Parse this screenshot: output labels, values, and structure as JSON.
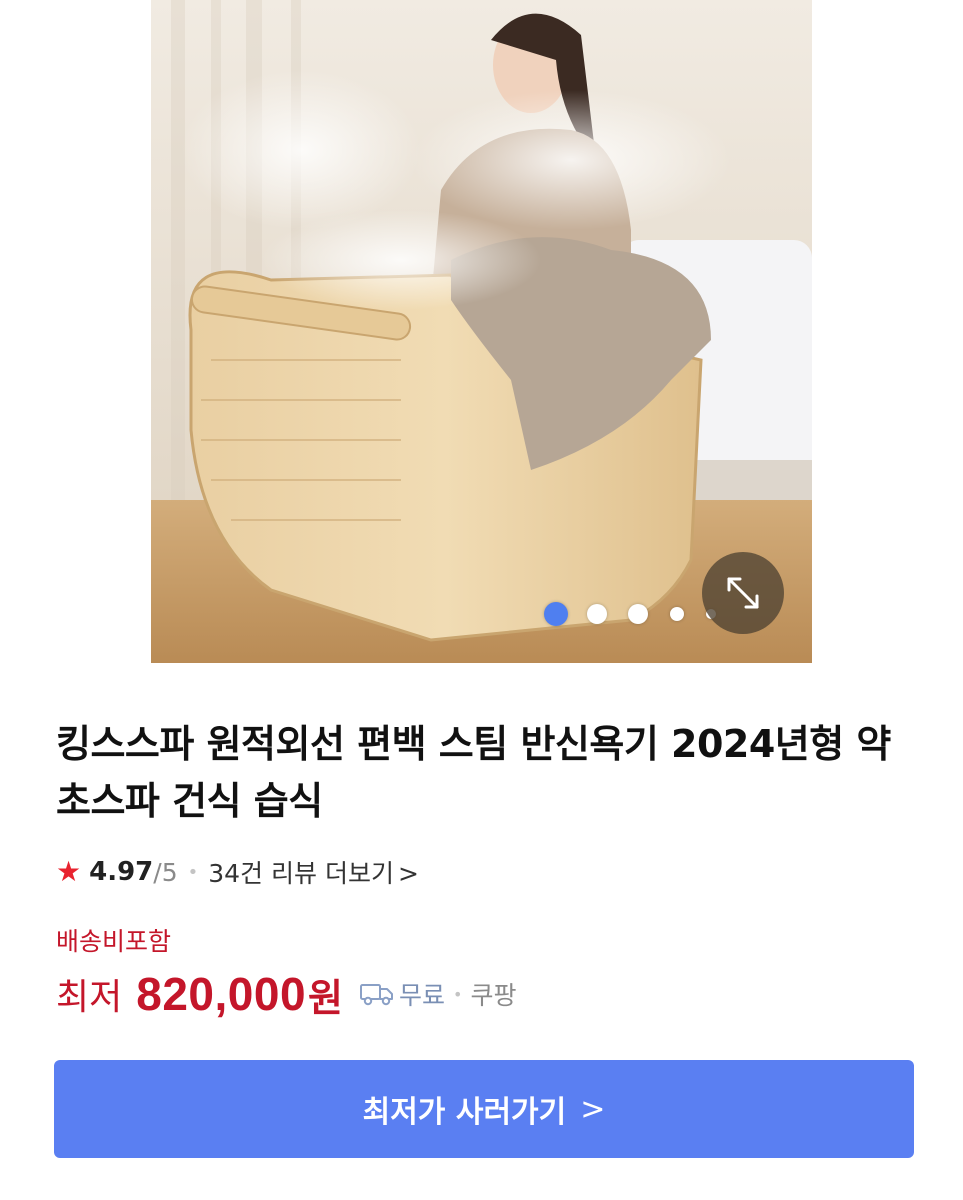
{
  "product": {
    "image_alt": "Wooden steam half-bath spa with woman",
    "carousel": {
      "total": 5,
      "active_index": 0
    },
    "title": "킹스스파 원적외선 편백 스팀 반신욕기 2024년형 약초스파 건식 습식",
    "rating": {
      "score": "4.97",
      "max": "/5",
      "review_link": "34건 리뷰 더보기",
      "chevron": ">"
    }
  },
  "pricing": {
    "shipping_label": "배송비포함",
    "prefix": "최저",
    "value": "820,000",
    "unit": "원",
    "delivery": "무료",
    "seller": "쿠팡"
  },
  "cta": {
    "label": "최저가 사러가기",
    "chevron": ">"
  },
  "colors": {
    "accent_blue": "#5a7ff2",
    "price_red": "#c4162a",
    "star_red": "#e8232f"
  },
  "icons": {
    "expand": "expand-icon",
    "star": "star-icon",
    "truck": "truck-icon"
  }
}
